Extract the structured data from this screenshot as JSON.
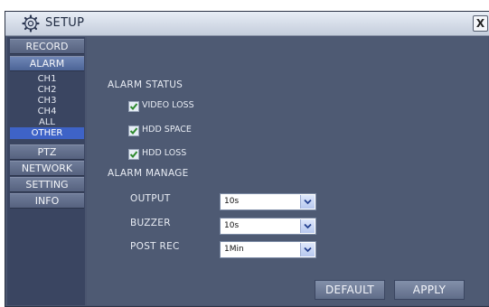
{
  "window": {
    "title": "SETUP",
    "close_label": "X"
  },
  "sidebar": {
    "record": "RECORD",
    "alarm": "ALARM",
    "alarm_sub": [
      "CH1",
      "CH2",
      "CH3",
      "CH4",
      "ALL",
      "OTHER"
    ],
    "selected_sub": "OTHER",
    "ptz": "PTZ",
    "network": "NETWORK",
    "setting": "SETTING",
    "info": "INFO"
  },
  "alarm_status": {
    "heading": "ALARM STATUS",
    "video_loss": {
      "label": "VIDEO LOSS",
      "checked": true
    },
    "hdd_space": {
      "label": "HDD SPACE",
      "checked": true
    },
    "hdd_loss": {
      "label": "HDD LOSS",
      "checked": true
    }
  },
  "alarm_manage": {
    "heading": "ALARM MANAGE",
    "output": {
      "label": "OUTPUT",
      "value": "10s"
    },
    "buzzer": {
      "label": "BUZZER",
      "value": "10s"
    },
    "post_rec": {
      "label": "POST REC",
      "value": "1Min"
    }
  },
  "buttons": {
    "default": "DEFAULT",
    "apply": "APPLY"
  },
  "icons": {
    "title": "gear-icon",
    "dropdown": "chevron-down-icon",
    "check": "checkmark-icon"
  },
  "colors": {
    "panel": "#4e5a73",
    "sidebar": "#3a4561",
    "selected": "#3e63c7",
    "check": "#2e8a2e"
  }
}
